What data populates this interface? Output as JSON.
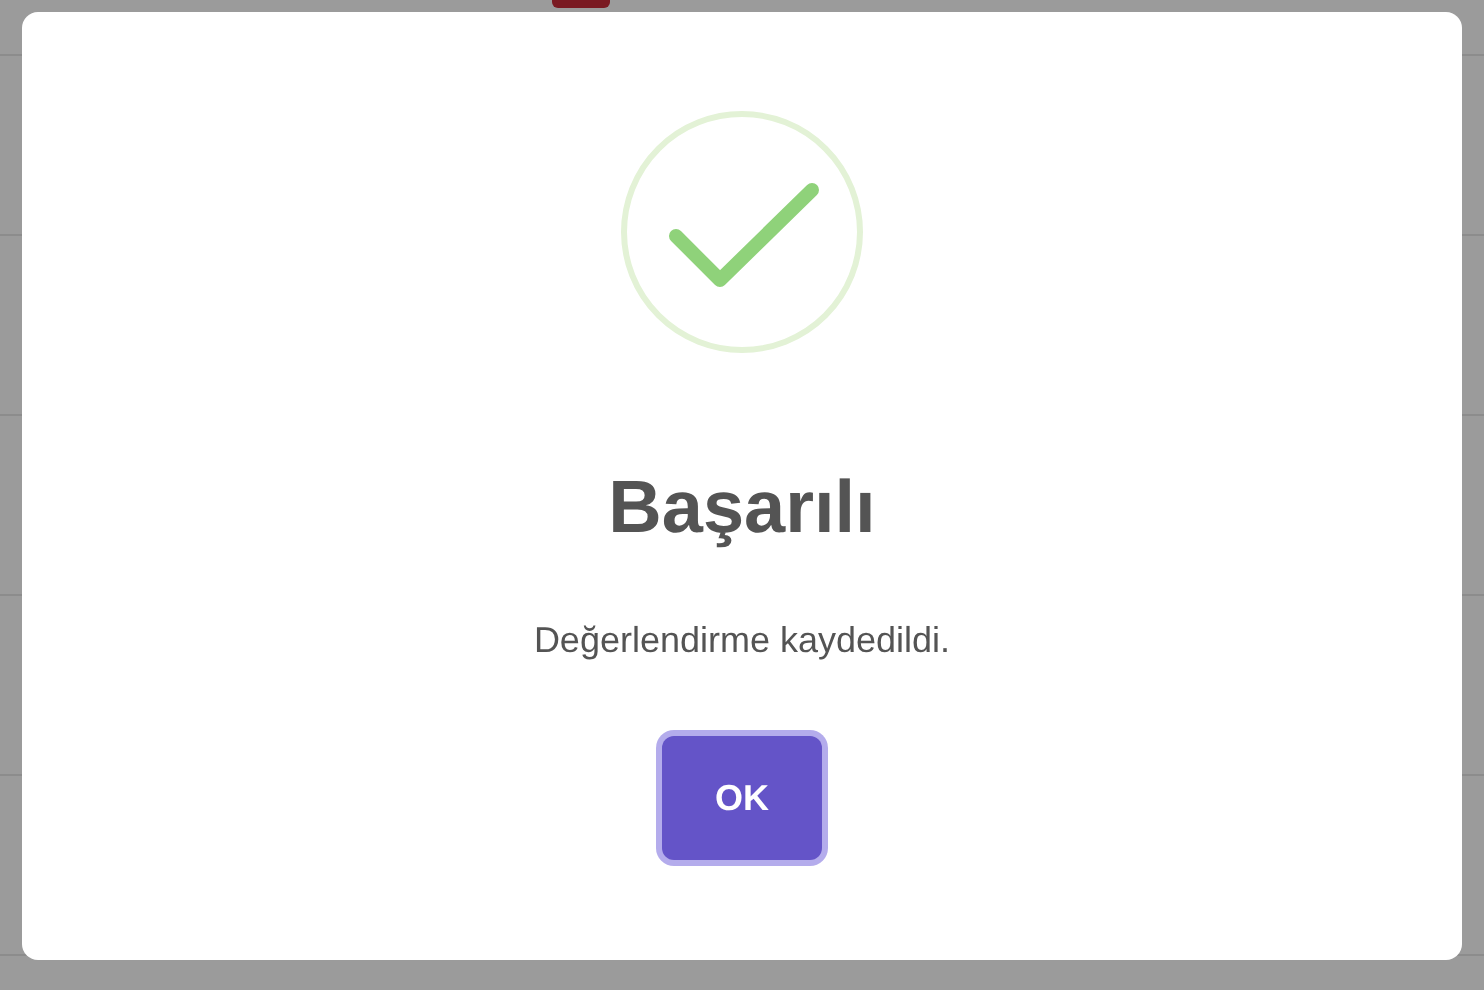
{
  "dialog": {
    "kind": "success",
    "title": "Başarılı",
    "message": "Değerlendirme kaydedildi.",
    "buttons": [
      {
        "label": "OK",
        "focused": true
      }
    ]
  }
}
